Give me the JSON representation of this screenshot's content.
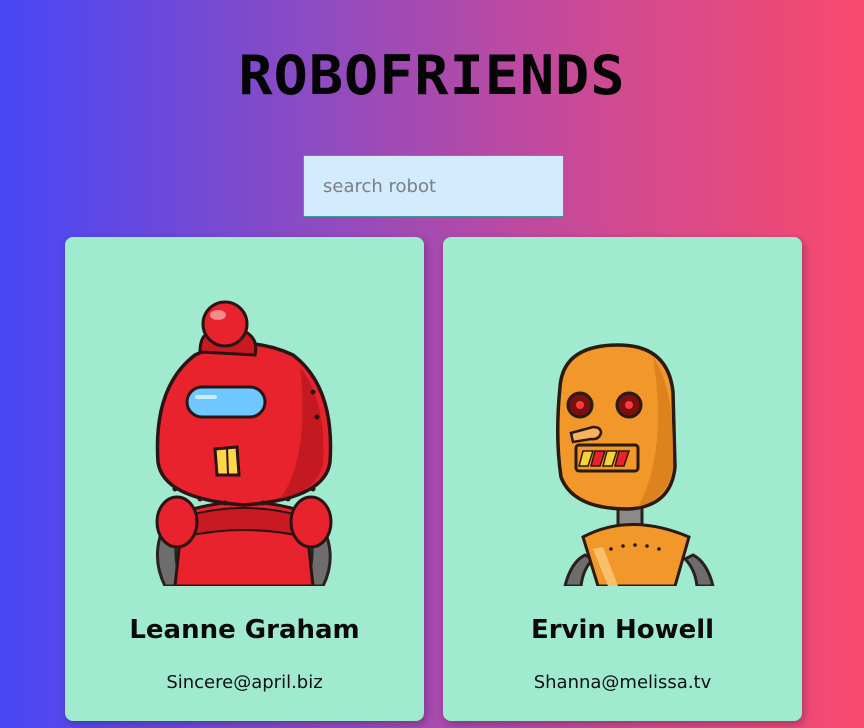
{
  "header": {
    "title": "ROBOFRIENDS"
  },
  "search": {
    "placeholder": "search robot",
    "value": ""
  },
  "robots": [
    {
      "name": "Leanne Graham",
      "email": "Sincere@april.biz",
      "color": "#e8232d"
    },
    {
      "name": "Ervin Howell",
      "email": "Shanna@melissa.tv",
      "color": "#f2982a"
    }
  ],
  "colors": {
    "card_background": "#a0ead0",
    "search_background": "#d2ecfd",
    "gradient_left": "#4647f6",
    "gradient_right": "#f84a6c"
  }
}
